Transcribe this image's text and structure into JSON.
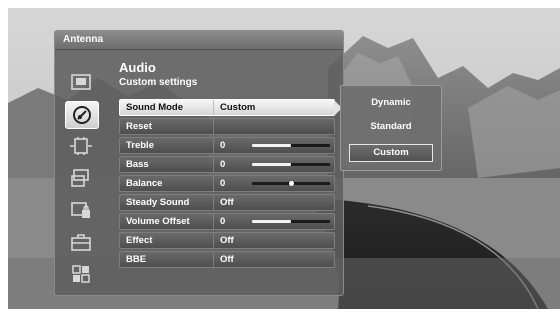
{
  "header": {
    "title": "Antenna"
  },
  "section": {
    "title": "Audio",
    "subtitle": "Custom settings"
  },
  "sidebar": {
    "items": [
      {
        "icon": "picture-icon",
        "active": false
      },
      {
        "icon": "sound-icon",
        "active": true
      },
      {
        "icon": "channel-icon",
        "active": false
      },
      {
        "icon": "setup-icon",
        "active": false
      },
      {
        "icon": "lock-icon",
        "active": false
      },
      {
        "icon": "toolbox-icon",
        "active": false
      },
      {
        "icon": "apps-icon",
        "active": false
      }
    ]
  },
  "settings": [
    {
      "label": "Sound Mode",
      "value": "Custom",
      "selected": true
    },
    {
      "label": "Reset",
      "value": ""
    },
    {
      "label": "Treble",
      "value": "0",
      "slider": 0.5
    },
    {
      "label": "Bass",
      "value": "0",
      "slider": 0.5
    },
    {
      "label": "Balance",
      "value": "0",
      "slider": 0.5,
      "knob": true
    },
    {
      "label": "Steady Sound",
      "value": "Off"
    },
    {
      "label": "Volume Offset",
      "value": "0",
      "slider": 0.5
    },
    {
      "label": "Effect",
      "value": "Off"
    },
    {
      "label": "BBE",
      "value": "Off"
    }
  ],
  "sound_mode_options": {
    "options": [
      "Dynamic",
      "Standard",
      "Custom"
    ],
    "selected": "Custom"
  }
}
